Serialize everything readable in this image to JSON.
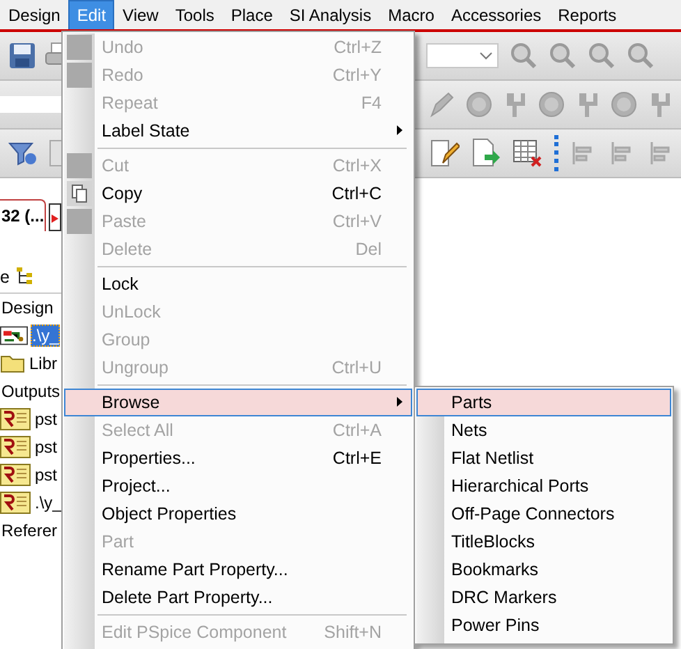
{
  "menubar": {
    "items": [
      {
        "label": "Design",
        "selected": false
      },
      {
        "label": "Edit",
        "selected": true
      },
      {
        "label": "View",
        "selected": false
      },
      {
        "label": "Tools",
        "selected": false
      },
      {
        "label": "Place",
        "selected": false
      },
      {
        "label": "SI Analysis",
        "selected": false
      },
      {
        "label": "Macro",
        "selected": false
      },
      {
        "label": "Accessories",
        "selected": false
      },
      {
        "label": "Reports",
        "selected": false
      }
    ]
  },
  "project_panel": {
    "document_tab": "32 (...",
    "panel_tab": "e",
    "tree": [
      {
        "label": "Design",
        "kind": "group",
        "selected": false
      },
      {
        "label": ".\\y_",
        "kind": "schematic",
        "selected": true
      },
      {
        "label": "Libr",
        "kind": "folder",
        "selected": false
      },
      {
        "label": "Outputs",
        "kind": "group",
        "selected": false
      },
      {
        "label": "pst",
        "kind": "report",
        "selected": false
      },
      {
        "label": "pst",
        "kind": "report",
        "selected": false
      },
      {
        "label": "pst",
        "kind": "report",
        "selected": false
      },
      {
        "label": ".\\y_",
        "kind": "report",
        "selected": false
      },
      {
        "label": "Referer",
        "kind": "group",
        "selected": false
      }
    ]
  },
  "edit_menu": {
    "items": [
      {
        "kind": "item",
        "label": "Undo",
        "shortcut": "Ctrl+Z",
        "disabled": true,
        "icon": true,
        "selected": false
      },
      {
        "kind": "item",
        "label": "Redo",
        "shortcut": "Ctrl+Y",
        "disabled": true,
        "icon": true,
        "selected": false
      },
      {
        "kind": "item",
        "label": "Repeat",
        "shortcut": "F4",
        "disabled": true,
        "icon": false,
        "selected": false
      },
      {
        "kind": "submenu",
        "label": "Label State",
        "disabled": false,
        "icon": false,
        "selected": false
      },
      {
        "kind": "separator"
      },
      {
        "kind": "item",
        "label": "Cut",
        "shortcut": "Ctrl+X",
        "disabled": true,
        "icon": true,
        "selected": false
      },
      {
        "kind": "item",
        "label": "Copy",
        "shortcut": "Ctrl+C",
        "disabled": false,
        "icon": true,
        "selected": false
      },
      {
        "kind": "item",
        "label": "Paste",
        "shortcut": "Ctrl+V",
        "disabled": true,
        "icon": true,
        "selected": false
      },
      {
        "kind": "item",
        "label": "Delete",
        "shortcut": "Del",
        "disabled": true,
        "icon": false,
        "selected": false
      },
      {
        "kind": "separator"
      },
      {
        "kind": "item",
        "label": "Lock",
        "disabled": false,
        "icon": false,
        "selected": false
      },
      {
        "kind": "item",
        "label": "UnLock",
        "disabled": true,
        "icon": false,
        "selected": false
      },
      {
        "kind": "item",
        "label": "Group",
        "disabled": true,
        "icon": false,
        "selected": false
      },
      {
        "kind": "item",
        "label": "Ungroup",
        "shortcut": "Ctrl+U",
        "disabled": true,
        "icon": false,
        "selected": false
      },
      {
        "kind": "separator"
      },
      {
        "kind": "submenu",
        "label": "Browse",
        "disabled": false,
        "icon": false,
        "selected": true
      },
      {
        "kind": "item",
        "label": "Select All",
        "shortcut": "Ctrl+A",
        "disabled": true,
        "icon": false,
        "selected": false
      },
      {
        "kind": "item",
        "label": "Properties...",
        "shortcut": "Ctrl+E",
        "disabled": false,
        "icon": false,
        "selected": false
      },
      {
        "kind": "item",
        "label": "Project...",
        "disabled": false,
        "icon": false,
        "selected": false
      },
      {
        "kind": "item",
        "label": "Object Properties",
        "disabled": false,
        "icon": false,
        "selected": false
      },
      {
        "kind": "item",
        "label": "Part",
        "disabled": true,
        "icon": false,
        "selected": false
      },
      {
        "kind": "item",
        "label": "Rename Part Property...",
        "disabled": false,
        "icon": false,
        "selected": false
      },
      {
        "kind": "item",
        "label": "Delete Part Property...",
        "disabled": false,
        "icon": false,
        "selected": false
      },
      {
        "kind": "separator"
      },
      {
        "kind": "item",
        "label": "Edit PSpice Component",
        "shortcut": "Shift+N",
        "disabled": true,
        "icon": false,
        "selected": false
      }
    ]
  },
  "browse_submenu": {
    "items": [
      {
        "label": "Parts",
        "selected": true
      },
      {
        "label": "Nets",
        "selected": false
      },
      {
        "label": "Flat Netlist",
        "selected": false
      },
      {
        "label": "Hierarchical Ports",
        "selected": false
      },
      {
        "label": "Off-Page Connectors",
        "selected": false
      },
      {
        "label": "TitleBlocks",
        "selected": false
      },
      {
        "label": "Bookmarks",
        "selected": false
      },
      {
        "label": "DRC Markers",
        "selected": false
      },
      {
        "label": "Power Pins",
        "selected": false
      }
    ]
  }
}
